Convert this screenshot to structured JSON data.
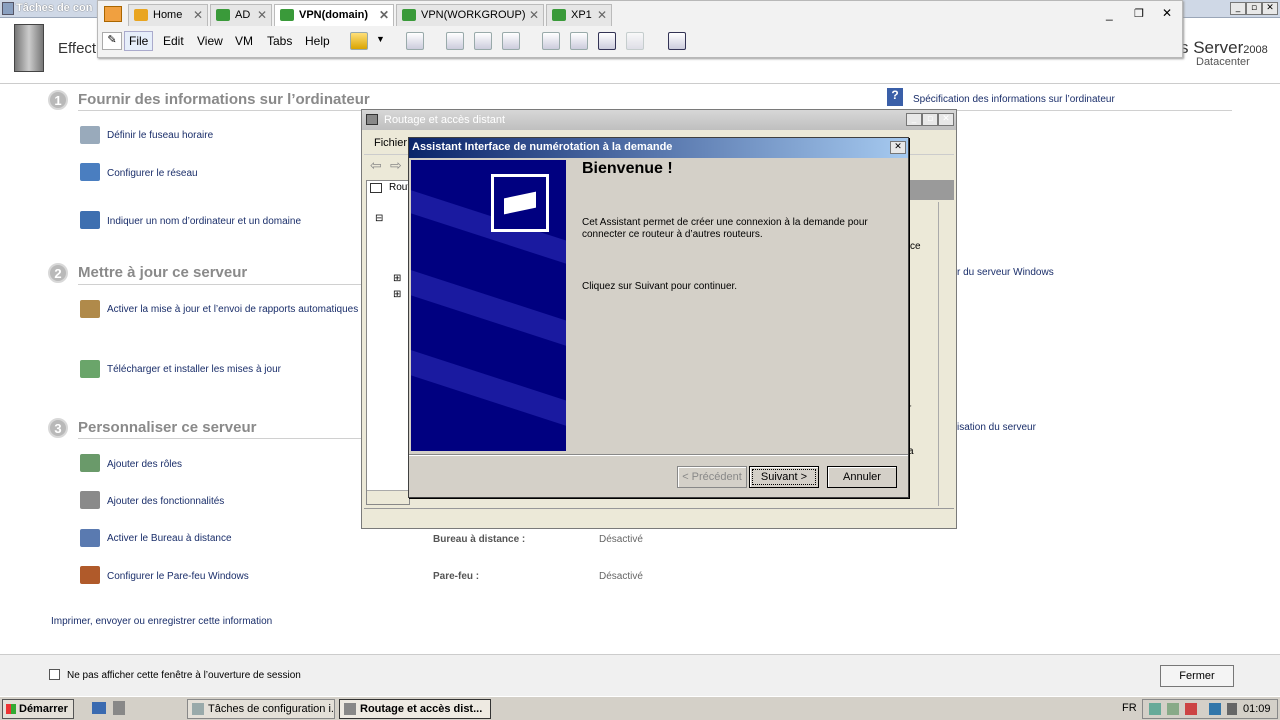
{
  "outer_window": {
    "title": "Tâches de con"
  },
  "vm_tabs": [
    {
      "label": "Home",
      "active": false
    },
    {
      "label": "AD",
      "active": false
    },
    {
      "label": "VPN(domain)",
      "active": true
    },
    {
      "label": "VPN(WORKGROUP)",
      "active": false
    },
    {
      "label": "XP1",
      "active": false
    }
  ],
  "vm_menu": [
    "File",
    "Edit",
    "View",
    "VM",
    "Tabs",
    "Help"
  ],
  "header": {
    "left_text": "Effect",
    "brand": "s Server",
    "brand_version": "2008",
    "edition": "Datacenter"
  },
  "sections": [
    {
      "number": "1",
      "title": "Fournir des informations sur l’ordinateur",
      "tasks": [
        "Définir le fuseau horaire",
        "Configurer le réseau",
        "Indiquer un nom d’ordinateur et un domaine"
      ]
    },
    {
      "number": "2",
      "title": "Mettre à jour ce serveur",
      "tasks": [
        "Activer la mise à jour et l’envoi de rapports automatiques",
        "Télécharger et installer les mises à jour"
      ]
    },
    {
      "number": "3",
      "title": "Personnaliser ce serveur",
      "tasks": [
        "Ajouter des rôles",
        "Ajouter des fonctionnalités",
        "Activer le Bureau à distance",
        "Configurer le Pare-feu Windows"
      ]
    }
  ],
  "right_links": {
    "spec": "Spécification des informations sur l’ordinateur",
    "update_partial": "r du serveur Windows",
    "custom_partial": "isation du serveur"
  },
  "info": {
    "rdp_label": "Bureau à distance :",
    "rdp_value": "Désactivé",
    "fw_label": "Pare-feu :",
    "fw_value": "Désactivé"
  },
  "print_link": "Imprimer, envoyer ou enregistrer cette information",
  "footer": {
    "checkbox_label": "Ne pas afficher cette fenêtre à l’ouverture de session",
    "close_button": "Fermer"
  },
  "rras": {
    "title": "Routage et accès distant",
    "menu_file": "Fichier",
    "tree_root": "Rout",
    "partials": [
      "ce",
      "r",
      "a"
    ]
  },
  "wizard": {
    "title": "Assistant Interface de numérotation à la demande",
    "heading": "Bienvenue !",
    "text1": "Cet Assistant permet de créer une connexion à la demande pour connecter ce routeur à d’autres routeurs.",
    "text2": "Cliquez sur Suivant pour continuer.",
    "btn_prev": "< Précédent",
    "btn_next": "Suivant >",
    "btn_cancel": "Annuler"
  },
  "taskbar": {
    "start": "Démarrer",
    "items": [
      "Tâches de configuration i...",
      "Routage et accès dist..."
    ],
    "lang": "FR",
    "clock": "01:09"
  },
  "colors": {
    "wizard_banner": "#000080",
    "title_active": "#0a246a",
    "link_text": "#1a2e6a"
  }
}
